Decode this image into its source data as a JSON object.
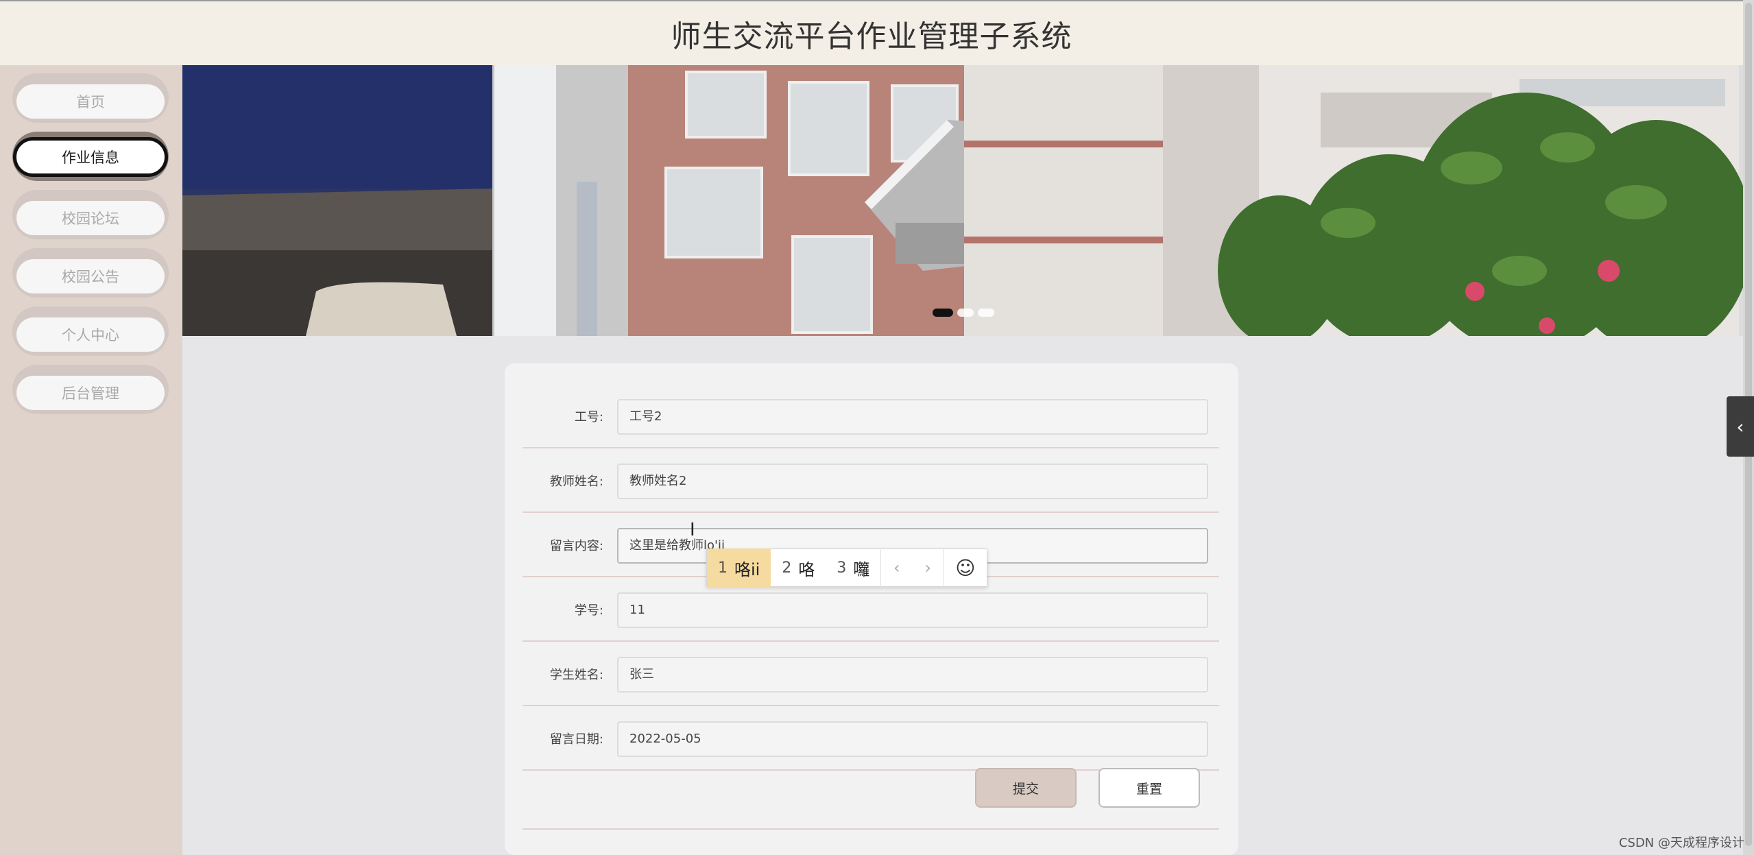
{
  "header": {
    "title": "师生交流平台作业管理子系统"
  },
  "sidebar": {
    "items": [
      {
        "label": "首页"
      },
      {
        "label": "作业信息"
      },
      {
        "label": "校园论坛"
      },
      {
        "label": "校园公告"
      },
      {
        "label": "个人中心"
      },
      {
        "label": "后台管理"
      }
    ],
    "active_index": 1
  },
  "banner": {
    "slides": 3,
    "active_slide": 1
  },
  "form": {
    "fields": [
      {
        "label": "工号:",
        "value": "工号2"
      },
      {
        "label": "教师姓名:",
        "value": "教师姓名2"
      },
      {
        "label": "留言内容:",
        "value": "这里是给教师lo'ii"
      },
      {
        "label": "学号:",
        "value": "11"
      },
      {
        "label": "学生姓名:",
        "value": "张三"
      },
      {
        "label": "留言日期:",
        "value": "2022-05-05"
      }
    ],
    "submit_label": "提交",
    "reset_label": "重置"
  },
  "ime": {
    "candidates": [
      {
        "num": "1",
        "text": "咯ii"
      },
      {
        "num": "2",
        "text": "咯"
      },
      {
        "num": "3",
        "text": "囖"
      }
    ],
    "prev_icon": "chevron-left-icon",
    "next_icon": "chevron-right-icon",
    "emoji_icon": "smiley-icon"
  },
  "side_toggle_icon": "chevron-left-icon",
  "watermark": "CSDN @天成程序设计",
  "colors": {
    "header_bg": "#f4efe6",
    "sidebar_bg": "#dfd3cc",
    "submit_bg": "#d9cbc3",
    "ime_selected": "#f6dba0"
  }
}
